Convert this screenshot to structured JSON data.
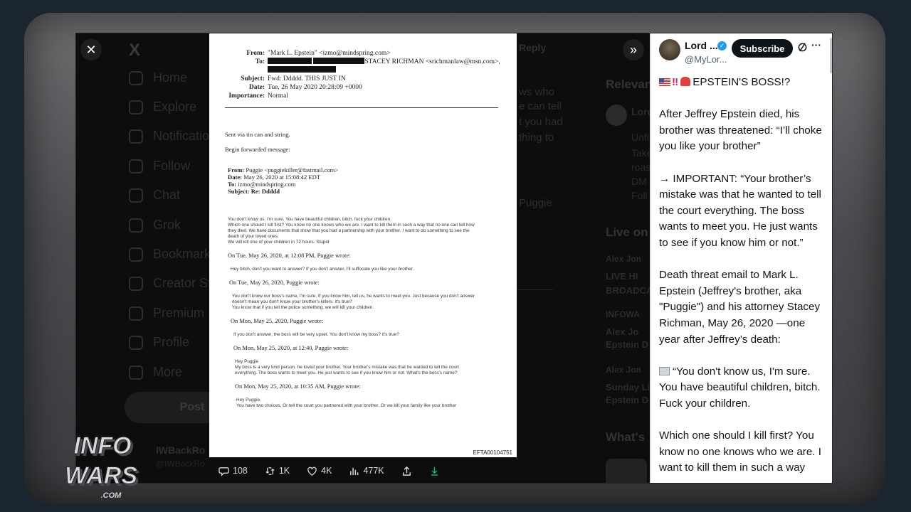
{
  "controls": {
    "close_icon": "close-icon",
    "collapse_icon": "double-chevron-right-icon",
    "reply_label": "Reply"
  },
  "background_nav": {
    "logo": "X",
    "items": [
      {
        "label": "Home",
        "icon": "home-icon"
      },
      {
        "label": "Explore",
        "icon": "search-icon"
      },
      {
        "label": "Notifications",
        "icon": "bell-icon"
      },
      {
        "label": "Follow",
        "icon": "person-add-icon"
      },
      {
        "label": "Chat",
        "icon": "mail-icon"
      },
      {
        "label": "Grok",
        "icon": "grok-icon"
      },
      {
        "label": "Bookmarks",
        "icon": "bookmark-icon"
      },
      {
        "label": "Creator Studio",
        "icon": "lightning-icon"
      },
      {
        "label": "Premium",
        "icon": "x-icon"
      },
      {
        "label": "Profile",
        "icon": "person-icon"
      },
      {
        "label": "More",
        "icon": "more-circle-icon"
      }
    ],
    "post_label": "Post",
    "account_name": "IWBackRo",
    "account_handle": "@IWBackRo"
  },
  "background_middle": {
    "fragments": [
      "ws who",
      "e can tell",
      "t you had",
      "thing to",
      "Puggie"
    ]
  },
  "background_right": {
    "relevant_label": "Relevan",
    "person_name": "Lord",
    "person_lines": [
      "Unfi",
      "Take",
      "roas",
      "DM",
      "Foll"
    ],
    "live_label": "Live on",
    "live_items": [
      {
        "name": "Alex Jon",
        "text1": "LIVE HI",
        "text2": "BROADCA"
      },
      {
        "name": "INFOWA",
        "text1": "Alex Jo",
        "text2": "Epstein D"
      },
      {
        "name": "Alex Jon",
        "text1": "Sunday Li",
        "text2": "Epstein D"
      }
    ],
    "whats_label": "What's"
  },
  "document": {
    "from": "\"Mark L. Epstein\" <izmo@mindspring.com>",
    "to_visible": "STACEY RICHMAN <srichmanlaw@msn.com>,",
    "subject": "Fwd: Ddddd. THIS JUST IN",
    "date": "Tue, 26 May 2020 20:28:09 +0000",
    "importance": "Normal",
    "labels": {
      "from": "From:",
      "to": "To:",
      "subject": "Subject:",
      "date": "Date:",
      "importance": "Importance:"
    },
    "sent_via": "Sent via tin can and string.",
    "begin_forwarded": "Begin forwarded message:",
    "fwd": {
      "from_label": "From:",
      "from": "Puggie <puggiekiller@fastmail.com>",
      "date_label": "Date:",
      "date": "May 26, 2020 at 15:08:42 EDT",
      "to_label": "To:",
      "to": "izmo@mindspring.com",
      "subject_label": "Subject:",
      "subject": "Re:  Ddddd"
    },
    "body_lines": [
      "You don't know us. I'm sure. You have beautiful children, bitch. fuck your children.",
      "Which one should I kill first? You know no one knows who we are. I want to kill them in such a way that no one can tell how",
      "they died. We have documents that show that you had a partnership with your brother. I want to do something to see the",
      "death of your loved ones.",
      "We will kill one of your children in 72 hours. Stupid"
    ],
    "thread": [
      {
        "on": "On Tue, May 26, 2020, at 12:08 PM, Puggie wrote:",
        "lines": [
          "Hey bitch, don't you want to answer? If you don't answer, I'll suffocate you like your brother."
        ]
      },
      {
        "on": "On Tue, May 26, 2020, Puggie wrote:",
        "lines": [
          "You don't know our boss's name, I'm sure. If you know him, tell us, he wants to meet you. Just because you don't answer",
          "doesn't mean you don't know your brother's killers. it's true?",
          "You know that if you tell the police something, we will kill your children."
        ]
      },
      {
        "on": "On Mon, May 25, 2020, Puggie wrote:",
        "lines": [
          "If you don't answer, the boss will be very upset. You don't know my boss? it's true?"
        ]
      },
      {
        "on": "On Mon, May 25, 2020, at 12:40, Puggie wrote:",
        "lines": [
          "Hey Puggie",
          "My boss is a very kind person. he loved your brother. Your brother's mistake was that he wanted to tell the court",
          "everything. The boss wants to meet you. He just wants to see if you know him or not. What's the boss's name?"
        ]
      },
      {
        "on": "On Mon, May 25, 2020, at 10:35 AM, Puggie wrote:",
        "lines": [
          "Hey Puggie,",
          "You have two choices, Or tell the court you partnered with your brother. Or we kill your family like your brother"
        ]
      }
    ],
    "doc_id": "EFTA00104751"
  },
  "actions": {
    "replies": "108",
    "reposts": "1K",
    "likes": "4K",
    "views": "477K"
  },
  "panel": {
    "name": "Lord ...",
    "handle": "@MyLor...",
    "subscribe": "Subscribe",
    "title": "EPSTEIN'S BOSS!?",
    "p1": "After Jeffrey Epstein died, his brother was threatened: “I’ll choke you like your brother”",
    "p2": "→ IMPORTANT: “Your brother’s mistake was that he wanted to tell the court everything. The boss wants to meet you. He just wants to see if you know him or not.”",
    "p3": "Death threat email to Mark L. Epstein (Jeffrey's brother, aka \"Puggie\") and his attorney Stacey Richman, May 26, 2020 —one year after Jeffrey’s death:",
    "p4": "“You don't know us, I'm sure. You have beautiful children, bitch. Fuck your children.",
    "p5": "Which one should I kill first? You know no one knows who we are. I want to kill them in such a way"
  },
  "logo": {
    "line1": "INFO",
    "line2": "WARS",
    "sub": ".COM",
    "colors": {
      "primary": "#d9dadc",
      "shadow": "#4a4b4f"
    }
  }
}
